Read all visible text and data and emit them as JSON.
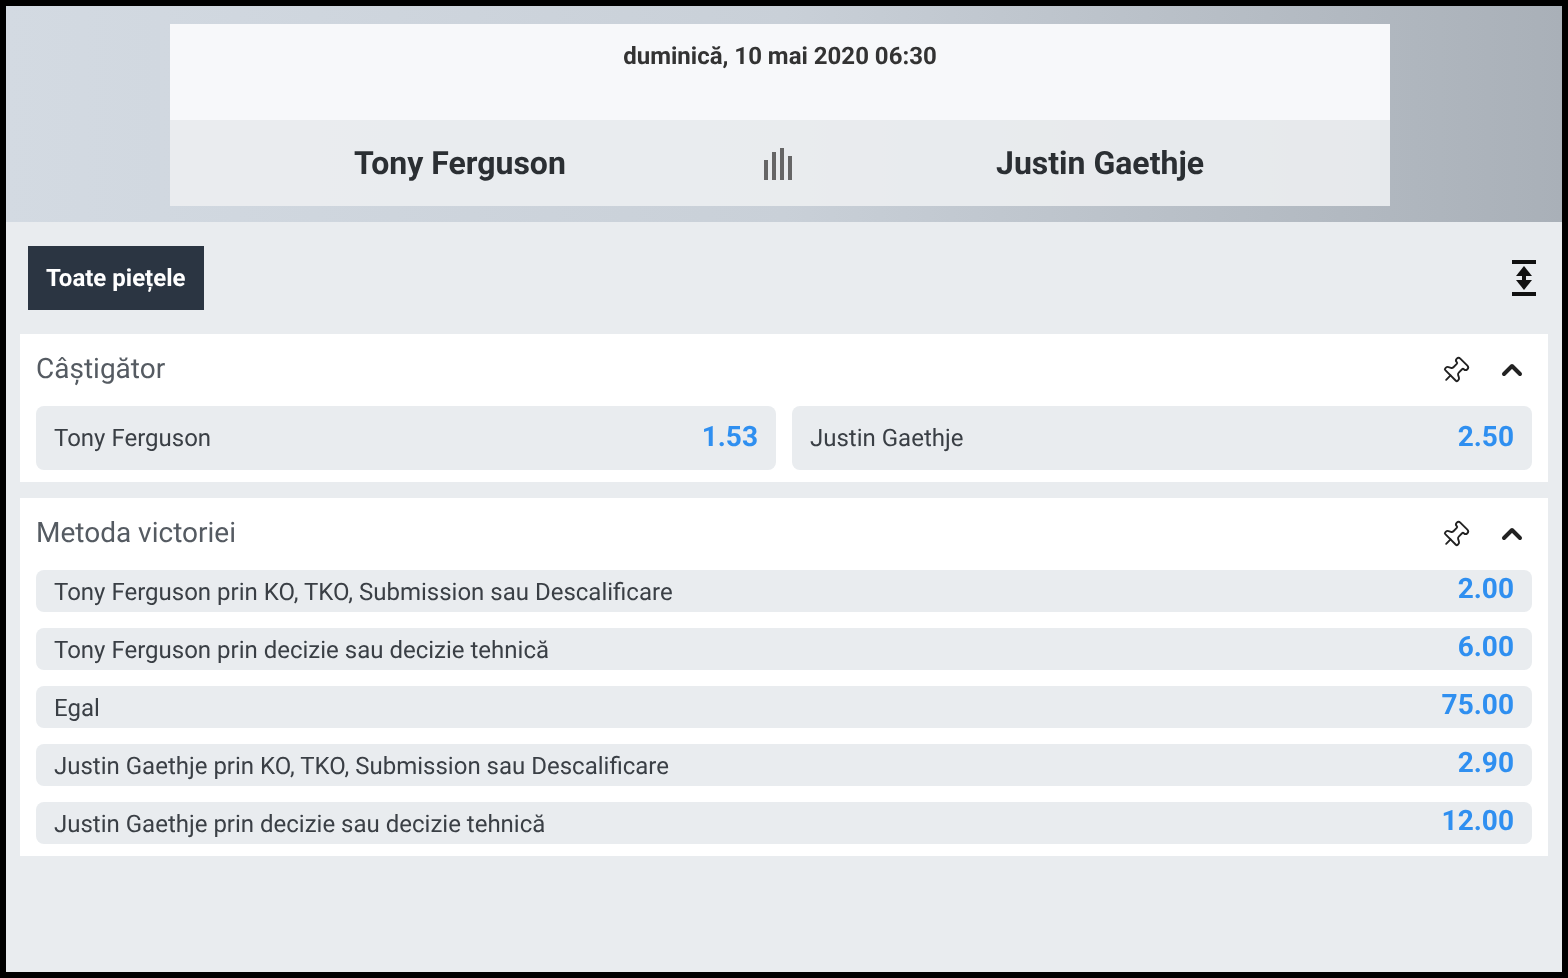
{
  "event": {
    "date": "duminică, 10 mai 2020 06:30",
    "home": "Tony Ferguson",
    "away": "Justin Gaethje"
  },
  "toolbar": {
    "button": "Toate piețele"
  },
  "markets": [
    {
      "title": "Câștigător",
      "kind": "columns",
      "expanded": true,
      "selections": [
        {
          "name": "Tony Ferguson",
          "odds": "1.53"
        },
        {
          "name": "Justin Gaethje",
          "odds": "2.50"
        }
      ]
    },
    {
      "title": "Metoda victoriei",
      "kind": "rows",
      "expanded": true,
      "selections": [
        {
          "name": "Tony Ferguson prin KO, TKO, Submission sau Descalificare",
          "odds": "2.00"
        },
        {
          "name": "Tony Ferguson prin decizie sau decizie tehnică",
          "odds": "6.00"
        },
        {
          "name": "Egal",
          "odds": "75.00"
        },
        {
          "name": "Justin Gaethje prin KO, TKO, Submission sau Descalificare",
          "odds": "2.90"
        },
        {
          "name": "Justin Gaethje prin decizie sau decizie tehnică",
          "odds": "12.00"
        }
      ]
    }
  ]
}
